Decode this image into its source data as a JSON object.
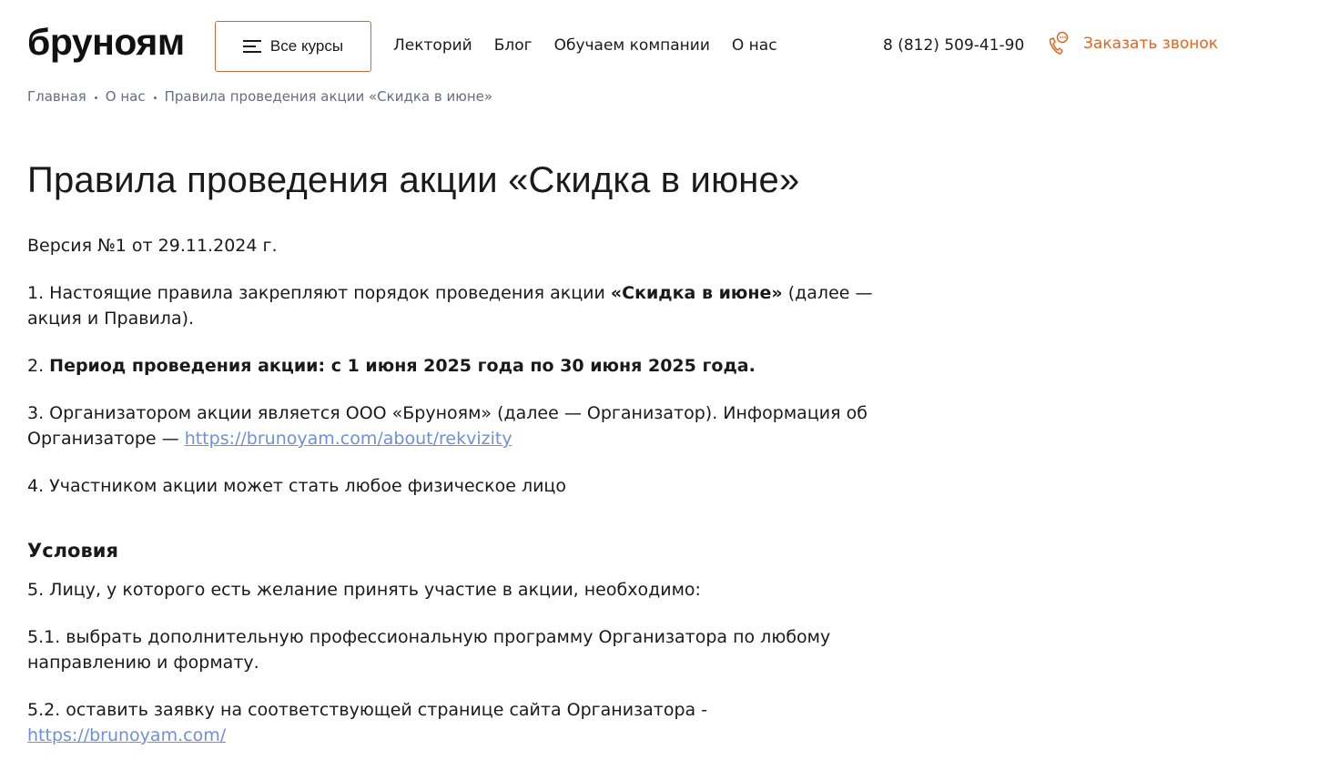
{
  "header": {
    "logo": "бруноям",
    "courses_button": "Все курсы",
    "nav": [
      "Лекторий",
      "Блог",
      "Обучаем компании",
      "О нас"
    ],
    "phone": "8 (812) 509-41-90",
    "callback_label": "Заказать звонок",
    "icons": {
      "menu": "menu-lines-icon",
      "callback": "phone-chat-icon"
    },
    "colors": {
      "accent": "#e0661f",
      "button_border": "#c86a3c",
      "link": "#6f8fd6"
    }
  },
  "breadcrumb": [
    "Главная",
    "О нас",
    "Правила проведения акции «Скидка в июне»"
  ],
  "main": {
    "title": "Правила проведения акции «Скидка в июне»",
    "version": "Версия №1 от 29.11.2024 г.",
    "p1": {
      "before": "1. Настоящие правила закрепляют порядок проведения акции ",
      "bold": "«Скидка в июне»",
      "after": " (далее — акция и Правила)."
    },
    "p2": {
      "before": "2. ",
      "bold": "Период проведения акции: с 1 июня 2025 года по 30 июня 2025 года."
    },
    "p3": {
      "text": "3. Организатором акции является ООО «Бруноям» (далее — Организатор). Информация об Организаторе — ",
      "link": "https://brunoyam.com/about/rekvizity"
    },
    "p4": "4. Участником акции может стать любое физическое лицо",
    "section_title": "Условия",
    "p5": "5. Лицу, у которого есть желание принять участие в акции, необходимо:",
    "p5_1": "5.1. выбрать дополнительную профессиональную программу Организатора по любому направлению и формату.",
    "p5_2": {
      "text": "5.2. оставить заявку на соответствующей странице сайта Организатора - ",
      "link": "https://brunoyam.com/"
    }
  }
}
